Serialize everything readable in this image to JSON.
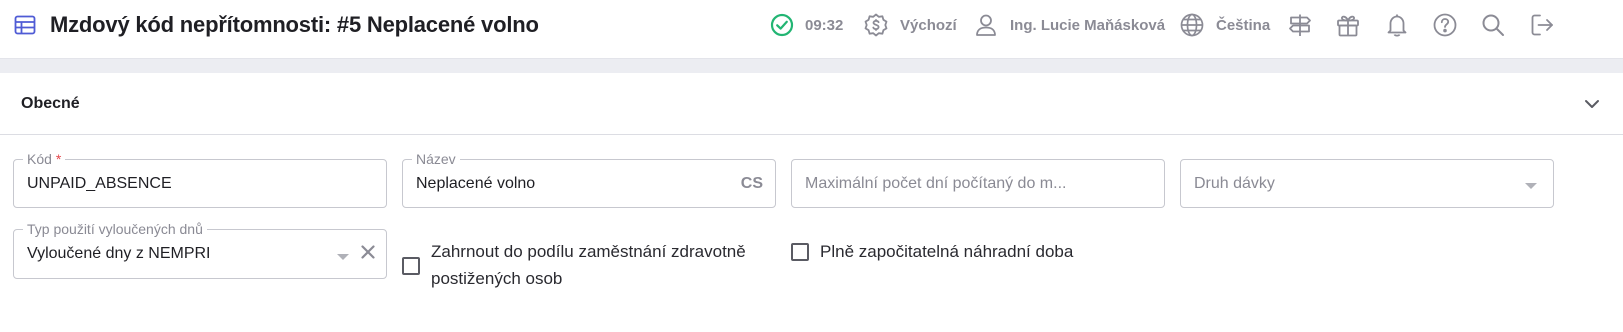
{
  "header": {
    "title": "Mzdový kód nepřítomnosti: #5 Neplacené volno",
    "time": "09:32",
    "currency_mode": "Výchozí",
    "user_name": "Ing. Lucie Maňásková",
    "language": "Čeština",
    "icons": [
      "table-icon",
      "status-check-icon",
      "currency-icon",
      "user-icon",
      "globe-icon",
      "signpost-icon",
      "gift-icon",
      "bell-icon",
      "help-icon",
      "search-icon",
      "logout-icon"
    ],
    "colors": {
      "accent": "#4f5bd5",
      "success": "#22b573",
      "muted": "#8b8b95"
    }
  },
  "section": {
    "title": "Obecné"
  },
  "form": {
    "code": {
      "label": "Kód",
      "required_mark": "*",
      "value": "UNPAID_ABSENCE"
    },
    "name": {
      "label": "Název",
      "value": "Neplacené volno",
      "lang_tag": "CS"
    },
    "max_days": {
      "placeholder": "Maximální počet dní počítaný do m..."
    },
    "benefit_type": {
      "placeholder": "Druh dávky"
    },
    "excluded_days_type": {
      "label": "Typ použití vyloučených dnů",
      "value": "Vyloučené dny z NEMPRI"
    },
    "include_disabled": {
      "label": "Zahrnout do podílu zaměstnání zdravotně postižených osob",
      "checked": false
    },
    "full_substitute": {
      "label": "Plně započitatelná náhradní doba",
      "checked": false
    }
  }
}
